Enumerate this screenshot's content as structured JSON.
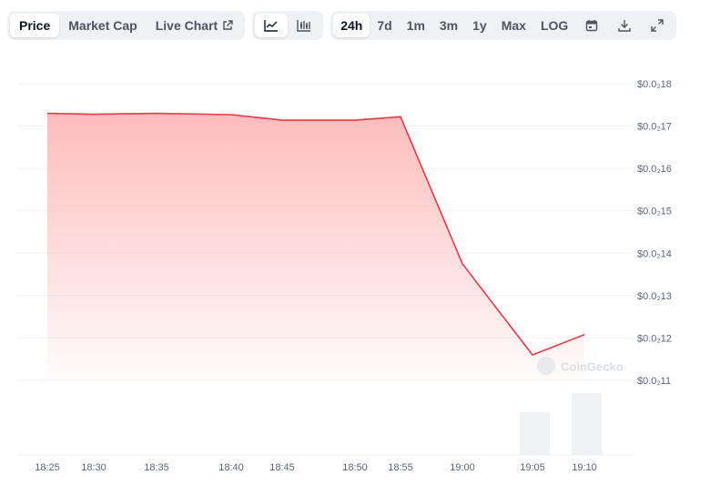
{
  "toolbar": {
    "tabs": [
      "Price",
      "Market Cap",
      "Live Chart"
    ],
    "chart_style_icons": [
      "line-chart-icon",
      "candlestick-chart-icon"
    ],
    "ranges": [
      "24h",
      "7d",
      "1m",
      "3m",
      "1y",
      "Max",
      "LOG"
    ],
    "tool_icons": [
      "calendar-icon",
      "download-icon",
      "expand-icon"
    ],
    "active_tab": "Price",
    "active_style": "line-chart-icon",
    "active_range": "24h"
  },
  "watermark": "CoinGecko",
  "colors": {
    "line": "#ea3943",
    "area_top": "#ffbcbc",
    "volume": "#eff2f5",
    "grid": "#eff2f5",
    "axis_text": "#58667e"
  },
  "chart_data": {
    "type": "area",
    "title": "",
    "xlabel": "",
    "ylabel": "",
    "x": [
      "18:25",
      "18:30",
      "18:35",
      "18:40",
      "18:45",
      "18:50",
      "18:55",
      "19:00",
      "19:05",
      "19:10"
    ],
    "series": [
      {
        "values": [
          17.3,
          17.28,
          17.3,
          17.27,
          17.14,
          17.14,
          17.22,
          13.75,
          11.6,
          12.08
        ]
      }
    ],
    "volume": [
      null,
      null,
      null,
      null,
      null,
      null,
      null,
      null,
      1.0,
      1.45
    ],
    "ylim": [
      11,
      18
    ],
    "y_ticks": [
      "$0.0₂11",
      "$0.0₂12",
      "$0.0₂13",
      "$0.0₂14",
      "$0.0₂15",
      "$0.0₂16",
      "$0.0₂17",
      "$0.0₂18"
    ],
    "grid": true,
    "legend": "none"
  }
}
